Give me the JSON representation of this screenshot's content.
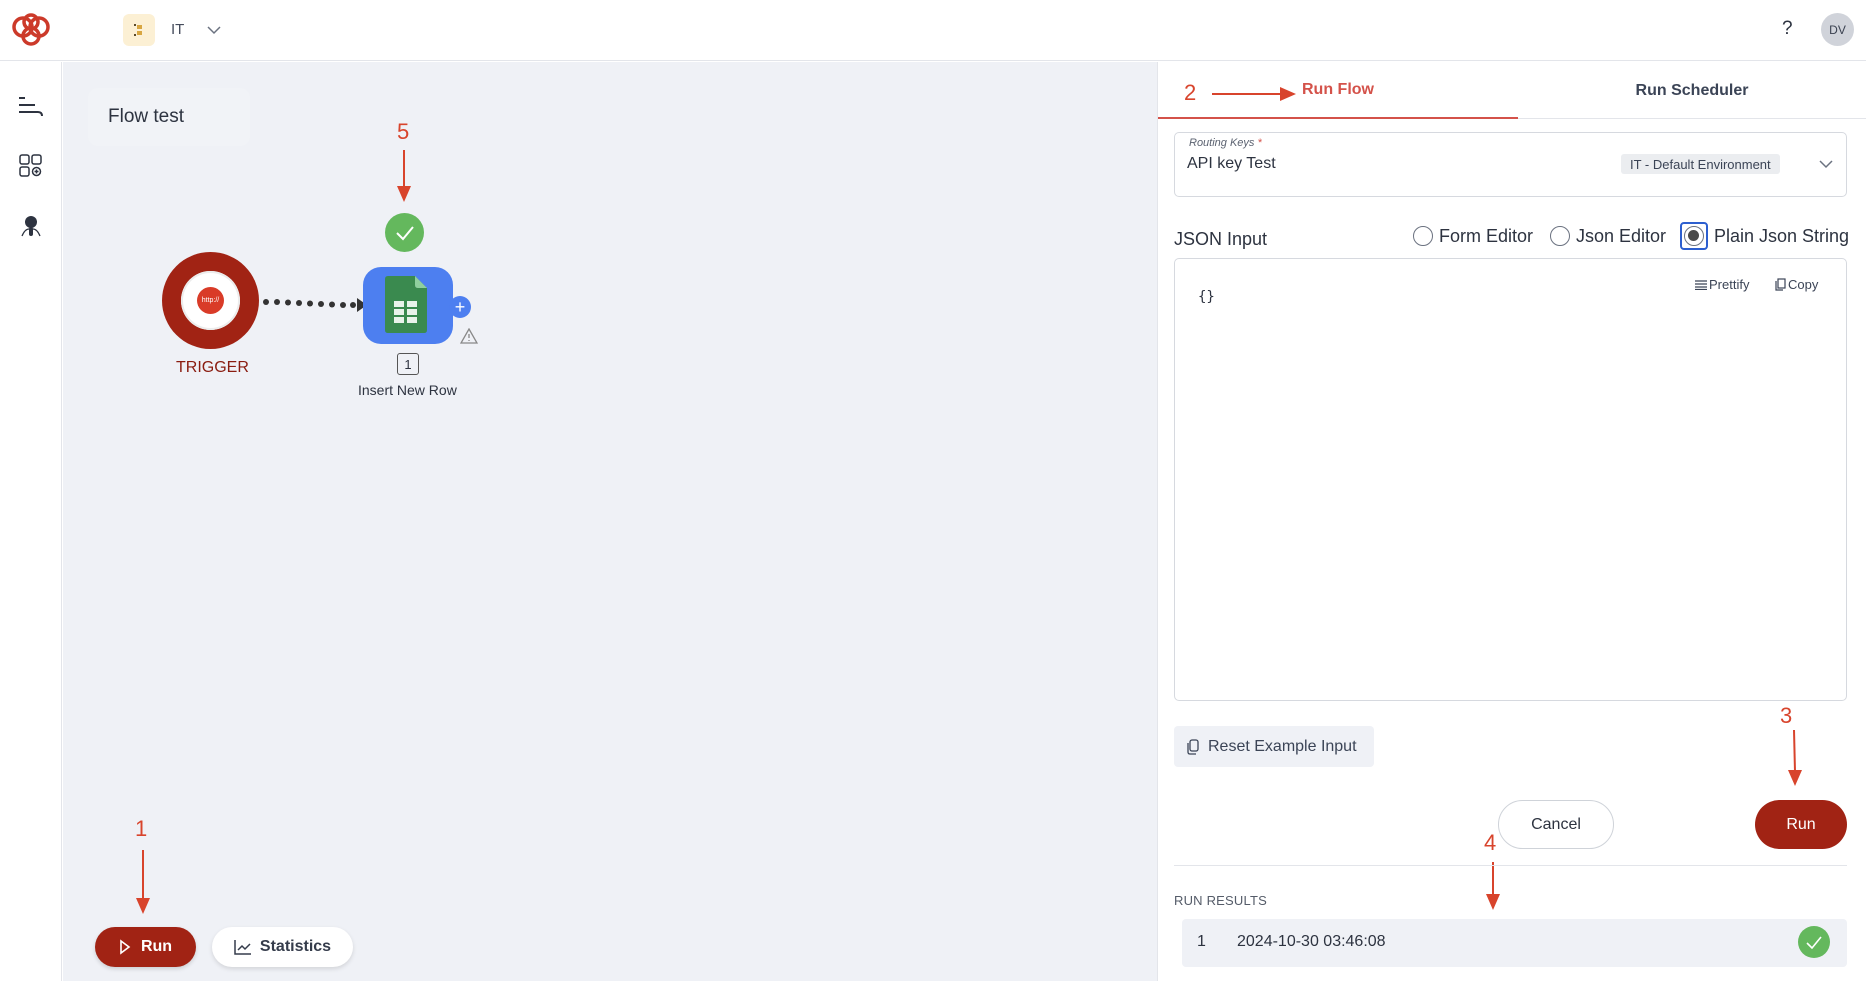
{
  "header": {
    "environment_name": "IT",
    "help_label": "?",
    "avatar_initials": "DV"
  },
  "sidebar": {
    "items": [
      {
        "icon": "flows-icon"
      },
      {
        "icon": "apps-icon"
      },
      {
        "icon": "agent-icon"
      }
    ]
  },
  "canvas": {
    "flow_title": "Flow test",
    "trigger": {
      "label": "TRIGGER",
      "icon_text": "http://"
    },
    "step": {
      "badge": "1",
      "label": "Insert New Row",
      "add_symbol": "+"
    },
    "run_button_label": "Run",
    "statistics_button_label": "Statistics"
  },
  "annotations": [
    "1",
    "2",
    "3",
    "4",
    "5"
  ],
  "panel": {
    "tabs": [
      {
        "label": "Run Flow",
        "active": true
      },
      {
        "label": "Run Scheduler",
        "active": false
      }
    ],
    "routing_keys": {
      "label": "Routing Keys",
      "required_mark": "*",
      "value": "API key Test",
      "environment": "IT - Default Environment"
    },
    "json_input": {
      "label": "JSON Input",
      "modes": [
        {
          "label": "Form Editor",
          "checked": false
        },
        {
          "label": "Json Editor",
          "checked": false
        },
        {
          "label": "Plain Json String",
          "checked": true
        }
      ],
      "value": "{}",
      "prettify_label": "Prettify",
      "copy_label": "Copy"
    },
    "reset_label": "Reset Example Input",
    "cancel_label": "Cancel",
    "run_label": "Run",
    "results": {
      "title": "RUN RESULTS",
      "rows": [
        {
          "index": "1",
          "timestamp": "2024-10-30 03:46:08",
          "status": "success"
        }
      ]
    }
  },
  "colors": {
    "brand": "#a12314",
    "active_tab": "#d4524a",
    "success": "#64b85d",
    "node": "#4d7ff0",
    "annotation": "#d8442c"
  }
}
